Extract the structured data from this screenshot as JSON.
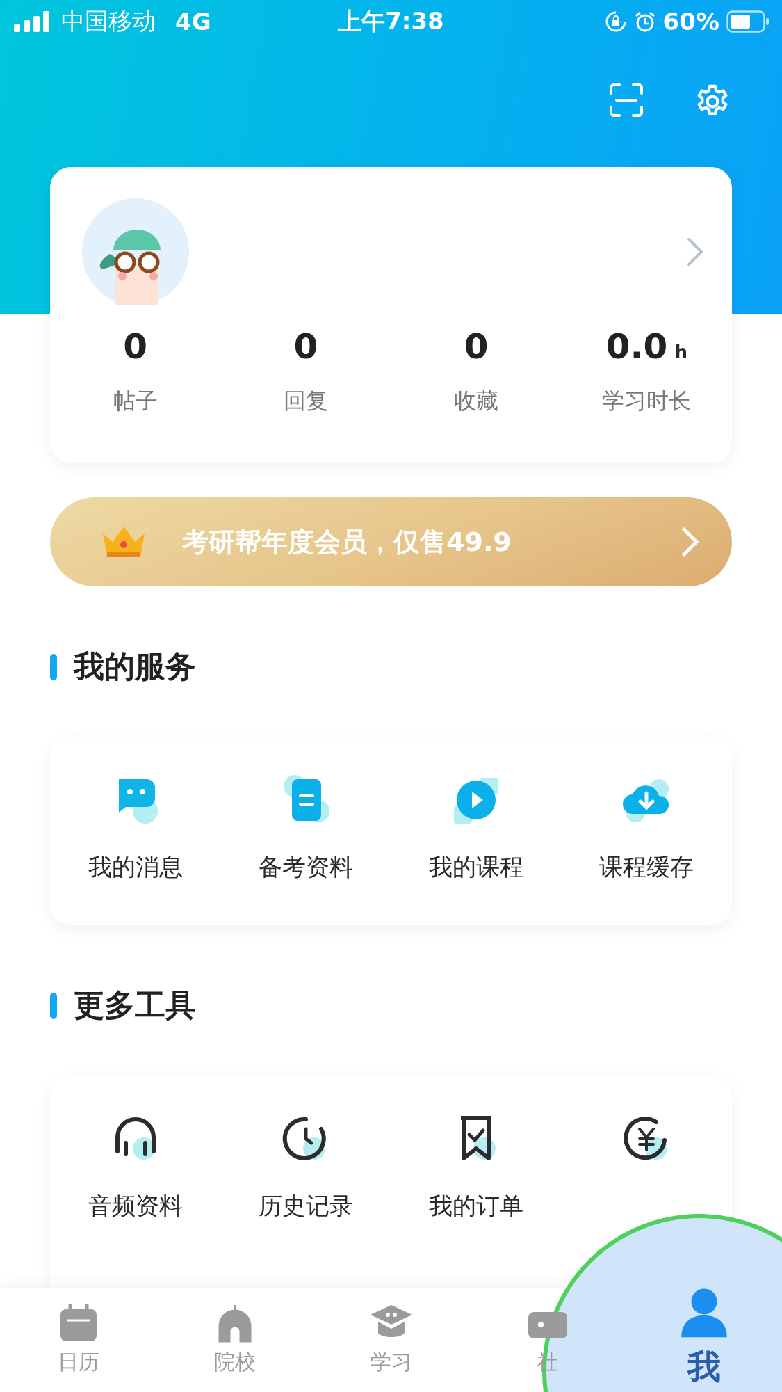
{
  "status_bar": {
    "carrier": "中国移动",
    "network": "4G",
    "time": "上午7:38",
    "battery": "60%"
  },
  "profile": {
    "stats": [
      {
        "value": "0",
        "label": "帖子"
      },
      {
        "value": "0",
        "label": "回复"
      },
      {
        "value": "0",
        "label": "收藏"
      },
      {
        "value": "0.0",
        "unit": "h",
        "label": "学习时长"
      }
    ]
  },
  "banner": {
    "text": "考研帮年度会员，仅售49.9"
  },
  "services": {
    "title": "我的服务",
    "items": [
      {
        "kind": "chat",
        "label": "我的消息"
      },
      {
        "kind": "doc",
        "label": "备考资料"
      },
      {
        "kind": "play",
        "label": "我的课程"
      },
      {
        "kind": "download",
        "label": "课程缓存"
      }
    ]
  },
  "tools": {
    "title": "更多工具",
    "items": [
      {
        "kind": "headphones",
        "label": "音频资料"
      },
      {
        "kind": "clock",
        "label": "历史记录"
      },
      {
        "kind": "bookmark",
        "label": "我的订单"
      },
      {
        "kind": "yuan"
      }
    ]
  },
  "tab_bar": [
    {
      "kind": "calendar",
      "label": "日历",
      "selected": false
    },
    {
      "kind": "school",
      "label": "院校",
      "selected": false
    },
    {
      "kind": "cap",
      "label": "学习",
      "selected": false
    },
    {
      "kind": "community",
      "label": "社",
      "selected": false
    },
    {
      "kind": "me",
      "label": "我",
      "selected": true
    }
  ]
}
